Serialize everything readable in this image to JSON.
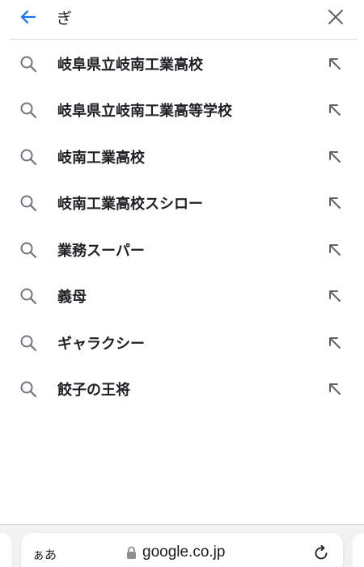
{
  "search": {
    "query": "ぎ"
  },
  "suggestions": [
    {
      "label": "岐阜県立岐南工業高校"
    },
    {
      "label": "岐阜県立岐南工業高等学校"
    },
    {
      "label": "岐南工業高校"
    },
    {
      "label": "岐南工業高校スシロー"
    },
    {
      "label": "業務スーパー"
    },
    {
      "label": "義母"
    },
    {
      "label": "ギャラクシー"
    },
    {
      "label": "餃子の王将"
    }
  ],
  "browser_bar": {
    "aa_label": "ぁあ",
    "url": "google.co.jp"
  },
  "colors": {
    "accent": "#1a73e8",
    "text": "#202124",
    "icon_gray": "#70757a"
  }
}
